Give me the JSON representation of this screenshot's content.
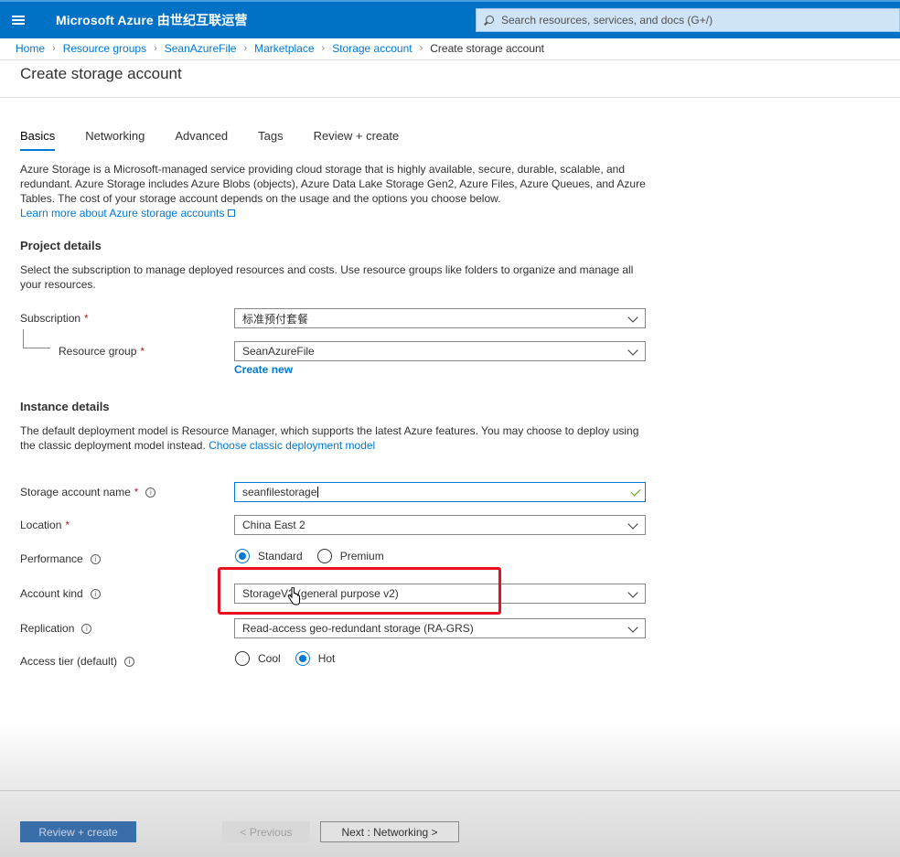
{
  "header": {
    "brand": "Microsoft Azure 由世纪互联运营",
    "search_placeholder": "Search resources, services, and docs (G+/)"
  },
  "breadcrumb": [
    "Home",
    "Resource groups",
    "SeanAzureFile",
    "Marketplace",
    "Storage account"
  ],
  "breadcrumb_current": "Create storage account",
  "page_title": "Create storage account",
  "tabs": [
    "Basics",
    "Networking",
    "Advanced",
    "Tags",
    "Review + create"
  ],
  "intro": {
    "text": "Azure Storage is a Microsoft-managed service providing cloud storage that is highly available, secure, durable, scalable, and redundant. Azure Storage includes Azure Blobs (objects), Azure Data Lake Storage Gen2, Azure Files, Azure Queues, and Azure Tables. The cost of your storage account depends on the usage and the options you choose below.",
    "link": "Learn more about Azure storage accounts"
  },
  "project": {
    "title": "Project details",
    "desc": "Select the subscription to manage deployed resources and costs. Use resource groups like folders to organize and manage all your resources.",
    "subscription_label": "Subscription",
    "subscription_value": "标准预付套餐",
    "rg_label": "Resource group",
    "rg_value": "SeanAzureFile",
    "create_new": "Create new"
  },
  "instance": {
    "title": "Instance details",
    "desc": "The default deployment model is Resource Manager, which supports the latest Azure features. You may choose to deploy using the classic deployment model instead.",
    "classic_link": "Choose classic deployment model",
    "name_label": "Storage account name",
    "name_value": "seanfilestorage",
    "location_label": "Location",
    "location_value": "China East 2",
    "performance_label": "Performance",
    "performance_options": [
      "Standard",
      "Premium"
    ],
    "kind_label": "Account kind",
    "kind_value": "StorageV2 (general purpose v2)",
    "replication_label": "Replication",
    "replication_value": "Read-access geo-redundant storage (RA-GRS)",
    "tier_label": "Access tier (default)",
    "tier_options": [
      "Cool",
      "Hot"
    ]
  },
  "required_mark": "*",
  "info_glyph": "i",
  "footer": {
    "review": "Review + create",
    "previous": "< Previous",
    "next": "Next : Networking >"
  },
  "colors": {
    "topbar": "#0072c6",
    "accent": "#0078d4",
    "highlight": "#e81123"
  }
}
